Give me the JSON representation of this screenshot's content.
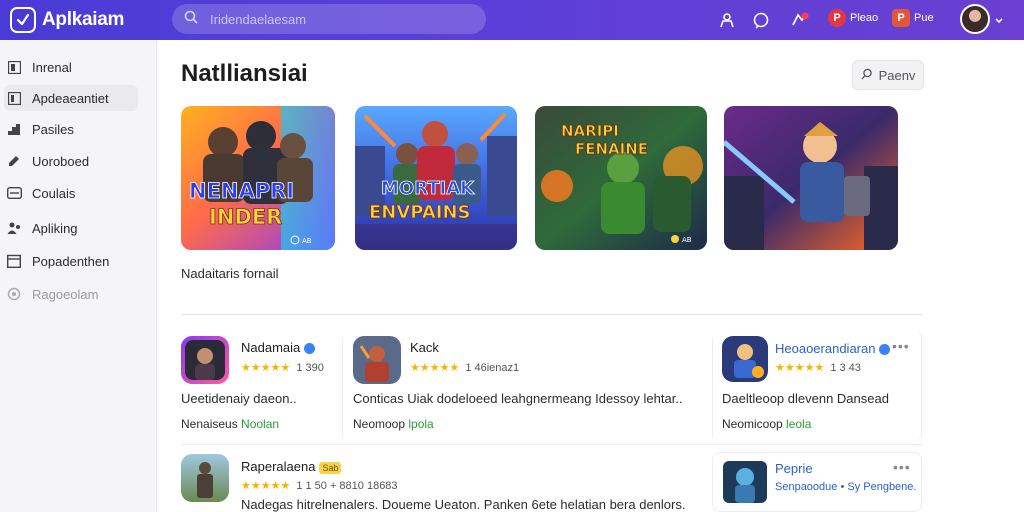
{
  "colors": {
    "topbar": "#4f3dd7",
    "accent_green": "#2e9a3a",
    "star": "#f5b400",
    "verified": "#3b82f6"
  },
  "header": {
    "app_name": "Aplkaiam",
    "search_placeholder": "Iridendaelaesam",
    "pills": [
      {
        "icon": "red-circle-icon",
        "label": "Pleao"
      },
      {
        "icon": "red-square-icon",
        "label": "Pue"
      }
    ]
  },
  "sidebar": {
    "items": [
      {
        "icon": "grid-icon",
        "label": "Inrenal"
      },
      {
        "icon": "square-icon",
        "label": "Apdeaeantiet"
      },
      {
        "icon": "chart-icon",
        "label": "Pasiles"
      },
      {
        "icon": "edit-icon",
        "label": "Uoroboed"
      },
      {
        "icon": "card-icon",
        "label": "Coulais"
      },
      {
        "icon": "users-icon",
        "label": "Apliking"
      },
      {
        "icon": "calendar-icon",
        "label": "Popadenthen"
      },
      {
        "icon": "settings-icon",
        "label": "Ragoeolam"
      }
    ]
  },
  "main": {
    "title": "Natlliansiai",
    "filter_label": "Paenv",
    "featured": [
      {
        "title": "NENAPRI INDER",
        "badge": "AB"
      },
      {
        "title": "MORTIAK ENVPAINS"
      },
      {
        "title": "NARIPI FENAINE",
        "badge": "AB"
      },
      {
        "title": ""
      }
    ],
    "featured_caption": "Nadaitaris fornail",
    "apps": [
      {
        "name": "Nadamaia",
        "rating": "★★★★★",
        "meta": "1 390",
        "desc": "Ueetidenaiy daeon..",
        "sub_prefix": "Nenaiseus",
        "sub_link": "Noolan"
      },
      {
        "name": "Kack",
        "rating": "★★★★★",
        "meta": "1 46ienaz1",
        "desc": "Conticas Uiak dodeloeed leahgnermeang Idessoy lehtar..",
        "sub_prefix": "Neomoop",
        "sub_link": "lpola"
      },
      {
        "name": "Heoaoerandiaran",
        "rating": "★★★★★",
        "meta": "1 3 43",
        "desc": "Daeltleoop dlevenn Dansead",
        "sub_prefix": "Neomicoop",
        "sub_link": "leola"
      },
      {
        "name": "Raperalaena",
        "tag": "Sab",
        "rating": "★★★★★",
        "meta": "1 1 50 + 8810 18683",
        "desc": "Nadegas hitrelnenalers. Doueme Ueaton. Panken 6ete helatian bera denlors."
      },
      {
        "name": "Peprie",
        "desc": "Senpaoodue • Sy Pengbene."
      }
    ]
  }
}
